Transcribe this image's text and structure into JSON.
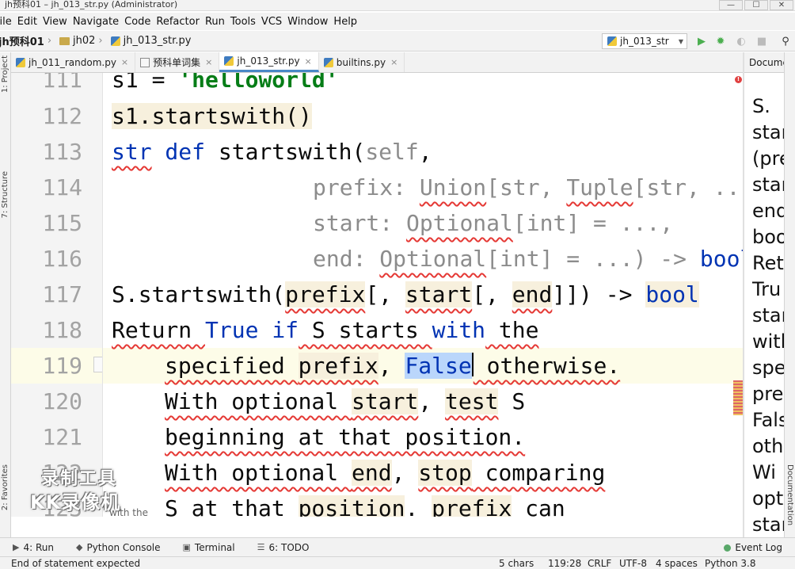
{
  "window": {
    "title": "jh预科01 – jh_013_str.py (Administrator)",
    "controls": [
      "—",
      "☐",
      "✕"
    ]
  },
  "menu": [
    "File",
    "Edit",
    "View",
    "Navigate",
    "Code",
    "Refactor",
    "Run",
    "Tools",
    "VCS",
    "Window",
    "Help"
  ],
  "breadcrumbs": {
    "project": "jh预科01",
    "folder": "jh02",
    "file": "jh_013_str.py"
  },
  "run_config": "jh_013_str",
  "tabs": [
    {
      "label": "jh_011_random.py",
      "active": false
    },
    {
      "label": "预科单词集",
      "active": false
    },
    {
      "label": "jh_013_str.py",
      "active": true
    },
    {
      "label": "builtins.py",
      "active": false
    }
  ],
  "editor": {
    "line_numbers": [
      "111",
      "112",
      "113",
      "114",
      "115",
      "116",
      "117",
      "118",
      "119",
      "120",
      "121",
      "122",
      "123"
    ],
    "current_line": "119",
    "lines": {
      "l111": {
        "a": "s1 = ",
        "b": "'helloworld'"
      },
      "l112": "s1.startswith()",
      "l113": {
        "a": "str",
        "b": " def ",
        "c": "startswith(",
        "d": "self",
        "e": ","
      },
      "l114": {
        "a": "prefix: ",
        "b": "Union",
        "c": "[str, ",
        "d": "Tuple",
        "e": "[str, ..."
      },
      "l115": {
        "a": "start: ",
        "b": "Optional",
        "c": "[int] = ...,"
      },
      "l116": {
        "a": "end: ",
        "b": "Optional",
        "c": "[int] = ...) -> ",
        "d": "bool"
      },
      "l117": {
        "a": "S.startswith(",
        "b": "prefix",
        "c": "[, ",
        "d": "start",
        "e": "[, ",
        "f": "end",
        "g": "]]) -> ",
        "h": "bool"
      },
      "l118": {
        "a": "Return ",
        "b": "True",
        "c": " ",
        "d": "if",
        "e": " S starts ",
        "f": "with",
        "g": " the"
      },
      "l119": {
        "a": "specified ",
        "b": "prefix",
        "c": ", ",
        "d": "False",
        "e": " otherwise."
      },
      "l120": {
        "a": "With optional ",
        "b": "start",
        "c": ", ",
        "d": "test",
        "e": " S"
      },
      "l121": "beginning at that position.",
      "l122": {
        "a": "With optional ",
        "b": "end",
        "c": ", ",
        "d": "stop",
        "e": " comparing"
      },
      "l123": {
        "a": "S at that ",
        "b": "position",
        "c": ". ",
        "d": "prefix",
        "e": " can"
      }
    },
    "hint": "with the"
  },
  "doc_panel": {
    "header": "Documentation",
    "lines": [
      "S.",
      "star",
      "(pre",
      "star",
      "end",
      "boo",
      "Ret",
      "Tru",
      "star",
      "with",
      "spe",
      "pre",
      "Fals",
      "oth",
      " Wi",
      "opt",
      "star"
    ]
  },
  "side_tools": {
    "left": [
      "1: Project",
      "7: Structure",
      "2: Favorites"
    ],
    "right": "Documentation"
  },
  "watermark": {
    "line1": "录制工具",
    "line2": "KK录像机"
  },
  "bottom_tools": [
    {
      "icon": "play-icon",
      "label": "4: Run"
    },
    {
      "icon": "python-console-icon",
      "label": "Python Console"
    },
    {
      "icon": "terminal-icon",
      "label": "Terminal"
    },
    {
      "icon": "todo-icon",
      "label": "6: TODO"
    }
  ],
  "event_log": "Event Log",
  "status": {
    "message": "End of statement expected",
    "selection": "5 chars",
    "position": "119:28",
    "line_sep": "CRLF",
    "encoding": "UTF-8",
    "indent": "4 spaces",
    "interpreter": "Python 3.8"
  }
}
